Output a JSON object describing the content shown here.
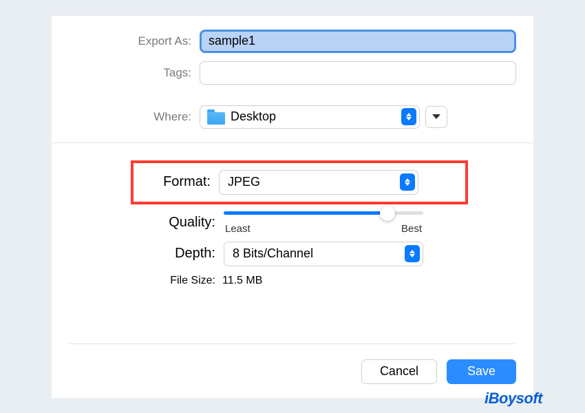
{
  "export_as": {
    "label": "Export As:",
    "value": "sample1"
  },
  "tags": {
    "label": "Tags:",
    "value": ""
  },
  "where": {
    "label": "Where:",
    "value": "Desktop"
  },
  "format": {
    "label": "Format:",
    "value": "JPEG"
  },
  "quality": {
    "label": "Quality:",
    "least_label": "Least",
    "best_label": "Best",
    "value_percent": 82
  },
  "depth": {
    "label": "Depth:",
    "value": "8 Bits/Channel"
  },
  "file_size": {
    "label": "File Size:",
    "value": "11.5 MB"
  },
  "buttons": {
    "cancel": "Cancel",
    "save": "Save"
  },
  "watermark": "iBoysoft"
}
